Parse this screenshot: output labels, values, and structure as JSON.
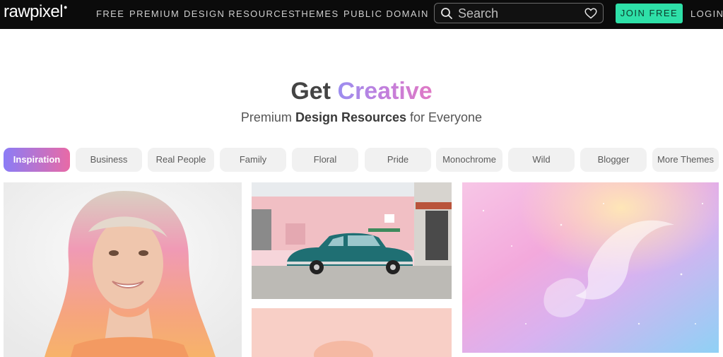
{
  "header": {
    "logo": "rawpixel",
    "nav": [
      "FREE",
      "PREMIUM",
      "DESIGN RESOURCES",
      "THEMES",
      "PUBLIC DOMAIN"
    ],
    "search_placeholder": "Search",
    "join_label": "JOIN FREE",
    "login_label": "LOGIN"
  },
  "hero": {
    "title_prefix": "Get",
    "title_highlight": "Creative",
    "subtitle_pre": "Premium",
    "subtitle_bold": "Design Resources",
    "subtitle_post": "for Everyone"
  },
  "themes": [
    "Inspiration",
    "Business",
    "Real People",
    "Family",
    "Floral",
    "Pride",
    "Monochrome",
    "Wild",
    "Blogger",
    "More Themes"
  ],
  "active_theme": "Inspiration",
  "colors": {
    "topbar": "#0b0b0b",
    "accent_green": "#2ee0a8",
    "pill_gradient_start": "#8b7cf6",
    "pill_gradient_end": "#e86aa6"
  },
  "icons": [
    "search-icon",
    "heart-icon"
  ]
}
